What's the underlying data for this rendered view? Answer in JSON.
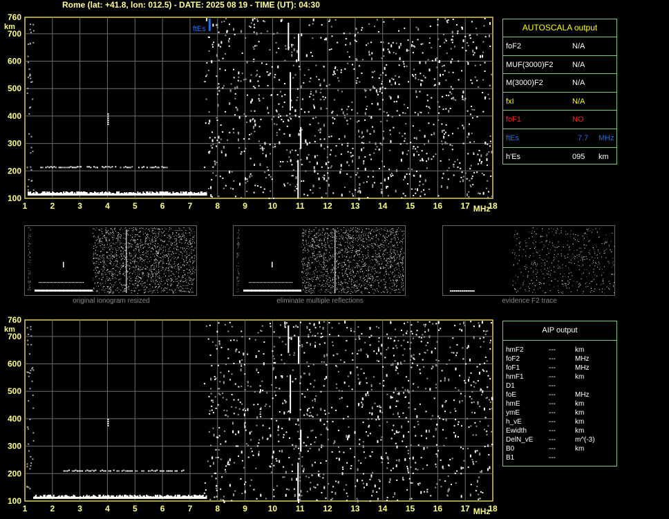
{
  "header": "Rome (lat: +41.8, lon: 012.5) - DATE: 2025 08 19 - TIME (UT): 04:30",
  "chart_data": [
    {
      "type": "scatter",
      "panel": "ionogram-top",
      "x_ticks": [
        "1",
        "2",
        "3",
        "4",
        "5",
        "6",
        "7",
        "8",
        "9",
        "10",
        "11",
        "12",
        "13",
        "14",
        "15",
        "16",
        "17",
        "18"
      ],
      "y_ticks": [
        "760",
        "700",
        "600",
        "500",
        "400",
        "300",
        "200",
        "100"
      ],
      "xlim": [
        1,
        18
      ],
      "ylim": [
        100,
        760
      ],
      "xlabel": "MHz",
      "ylabel": "km",
      "traces": [
        {
          "name": "ground-trace",
          "x": [
            1.1,
            7.6
          ],
          "y": [
            110,
            110
          ]
        },
        {
          "name": "multiple-reflection",
          "x": [
            1.5,
            6.2
          ],
          "y": [
            210,
            210
          ]
        },
        {
          "name": "spike-4MHz",
          "x": [
            4.0,
            4.0
          ],
          "y": [
            370,
            410
          ]
        }
      ],
      "marker": {
        "label": "ftEs",
        "x": 7.7,
        "y": 720,
        "color": "#1e6fd9"
      }
    },
    {
      "type": "scatter",
      "panel": "ionogram-bottom",
      "x_ticks": [
        "1",
        "2",
        "3",
        "4",
        "5",
        "6",
        "7",
        "8",
        "9",
        "10",
        "11",
        "12",
        "13",
        "14",
        "15",
        "16",
        "17",
        "18"
      ],
      "y_ticks": [
        "760",
        "700",
        "600",
        "500",
        "400",
        "300",
        "200",
        "100"
      ],
      "xlim": [
        1,
        18
      ],
      "ylim": [
        100,
        760
      ],
      "xlabel": "MHz",
      "ylabel": "km",
      "traces": [
        {
          "name": "ground-trace",
          "x": [
            1.3,
            7.6
          ],
          "y": [
            108,
            108
          ]
        },
        {
          "name": "multiple-reflection",
          "x": [
            2.4,
            6.9
          ],
          "y": [
            207,
            207
          ]
        },
        {
          "name": "spike-4MHz",
          "x": [
            4.0,
            4.0
          ],
          "y": [
            370,
            400
          ]
        }
      ]
    }
  ],
  "thumbnails": [
    {
      "caption": "original ionogram resized"
    },
    {
      "caption": "eliminate multiple reflections"
    },
    {
      "caption": "evidence F2 trace"
    }
  ],
  "autoscala": {
    "title": "AUTOSCALA output",
    "rows": [
      {
        "label": "foF2",
        "value": "N/A",
        "unit": "",
        "color": "#ffffff"
      },
      {
        "label": "MUF(3000)F2",
        "value": "N/A",
        "unit": "",
        "color": "#ffffff"
      },
      {
        "label": "M(3000)F2",
        "value": "N/A",
        "unit": "",
        "color": "#ffffff"
      },
      {
        "label": "fxI",
        "value": "N/A",
        "unit": "",
        "color": "#ffff00"
      },
      {
        "label": "foF1",
        "value": "NO",
        "unit": "",
        "color": "#ff2020"
      },
      {
        "label": "ftEs",
        "value": "7.7",
        "unit": "MHz",
        "color": "#1e6fd9"
      },
      {
        "label": "h'Es",
        "value": "095",
        "unit": "km",
        "color": "#ffffff"
      }
    ]
  },
  "aip": {
    "title": "AIP output",
    "rows": [
      {
        "label": "hmF2",
        "value": "---",
        "unit": "km"
      },
      {
        "label": "foF2",
        "value": "---",
        "unit": "MHz"
      },
      {
        "label": "foF1",
        "value": "---",
        "unit": "MHz"
      },
      {
        "label": "hmF1",
        "value": "---",
        "unit": "km"
      },
      {
        "label": "D1",
        "value": "---",
        "unit": ""
      },
      {
        "label": "foE",
        "value": "---",
        "unit": "MHz"
      },
      {
        "label": "hmE",
        "value": "---",
        "unit": "km"
      },
      {
        "label": "ymE",
        "value": "---",
        "unit": "km"
      },
      {
        "label": "h_vE",
        "value": "---",
        "unit": "km"
      },
      {
        "label": "Ewidth",
        "value": "---",
        "unit": "km"
      },
      {
        "label": "DelN_vE",
        "value": "---",
        "unit": "m^(-3)"
      },
      {
        "label": "B0",
        "value": "---",
        "unit": "km"
      },
      {
        "label": "B1",
        "value": "---",
        "unit": ""
      }
    ]
  }
}
